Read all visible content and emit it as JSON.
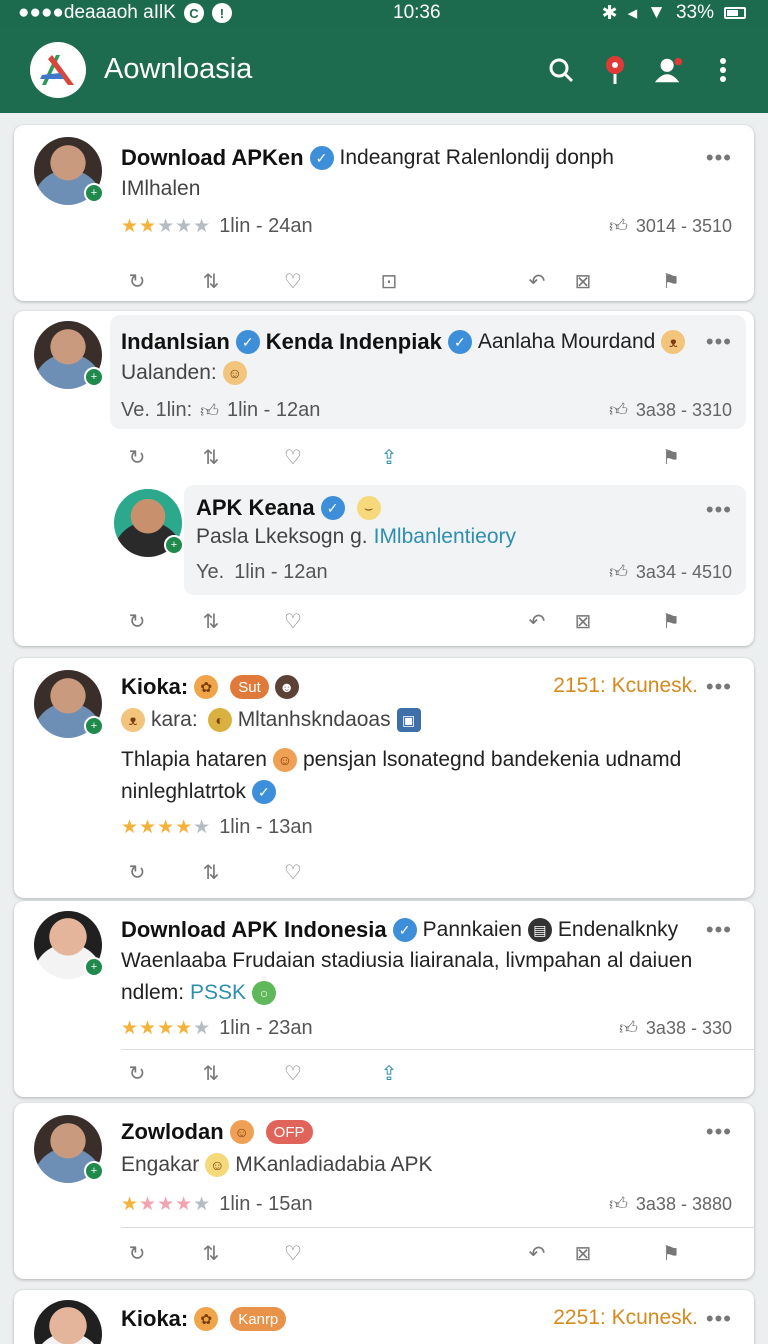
{
  "status_bar": {
    "carrier": "●●●●deaaaoh aIlK",
    "time": "10:36",
    "battery": "33%"
  },
  "app_bar": {
    "title": "Aownloasia",
    "icons": [
      "search-icon",
      "pin-icon",
      "user-alert-icon",
      "overflow-icon"
    ]
  },
  "colors": {
    "primary": "#1e6c50",
    "verified": "#3c8fd8",
    "star": "#f3b23a",
    "link": "#2d8fb0"
  },
  "posts": [
    {
      "name": "Download APKen",
      "header_text": "Indeangrat Ralenlondij donph",
      "subtitle": "IMlhalen",
      "rating": 2,
      "time": "1lin - 24an",
      "likes": "3014 - 3510"
    },
    {
      "name": "Indanlsian",
      "name2": "Kenda Indenpiak",
      "header_text": "Aanlaha Mourdand",
      "subtitle": "Ualanden:",
      "meta_prefix": "Ve. 1lin:",
      "time": "1lin - 12an",
      "likes": "3a38 - 3310",
      "reply": {
        "name": "APK Keana",
        "text": "Pasla Lkeksogn g.",
        "link": "IMlbanlentieory",
        "time_prefix": "Ye.",
        "time": "1lin - 12an",
        "likes": "3a34 - 4510"
      }
    },
    {
      "name": "Kioka:",
      "badge": "Sut",
      "meta_right": "2151: Kcunesk.",
      "subtitle_prefix": "kara:",
      "subtitle": "Mltanhskndaoas",
      "body_line1": "Thlapia hataren",
      "body_line1b": "pensjan lsonategnd bandekenia udnamd",
      "body_line2": "ninleghlatrtok",
      "rating": 4,
      "time": "1lin - 13an"
    },
    {
      "name": "Download APK Indonesia",
      "header_text": "Pannkaien",
      "header_text2": "Endenalknky",
      "body_line1": "Waenlaaba Frudaian stadiusia liairanala, livmpahan al daiuen",
      "body_line2_prefix": "ndlem:",
      "body_line2_link": "PSSK",
      "rating": 4,
      "time": "1lin - 23an",
      "likes": "3a38 - 330"
    },
    {
      "name": "Zowlodan",
      "badge": "OFP",
      "subtitle_prefix": "Engakar",
      "subtitle": "MKanladiadabia APK",
      "rating": 4,
      "time": "1lin - 15an",
      "likes": "3a38 - 3880"
    },
    {
      "name": "Kioka:",
      "badge": "Kanrp",
      "meta_right": "2251: Kcunesk."
    }
  ]
}
